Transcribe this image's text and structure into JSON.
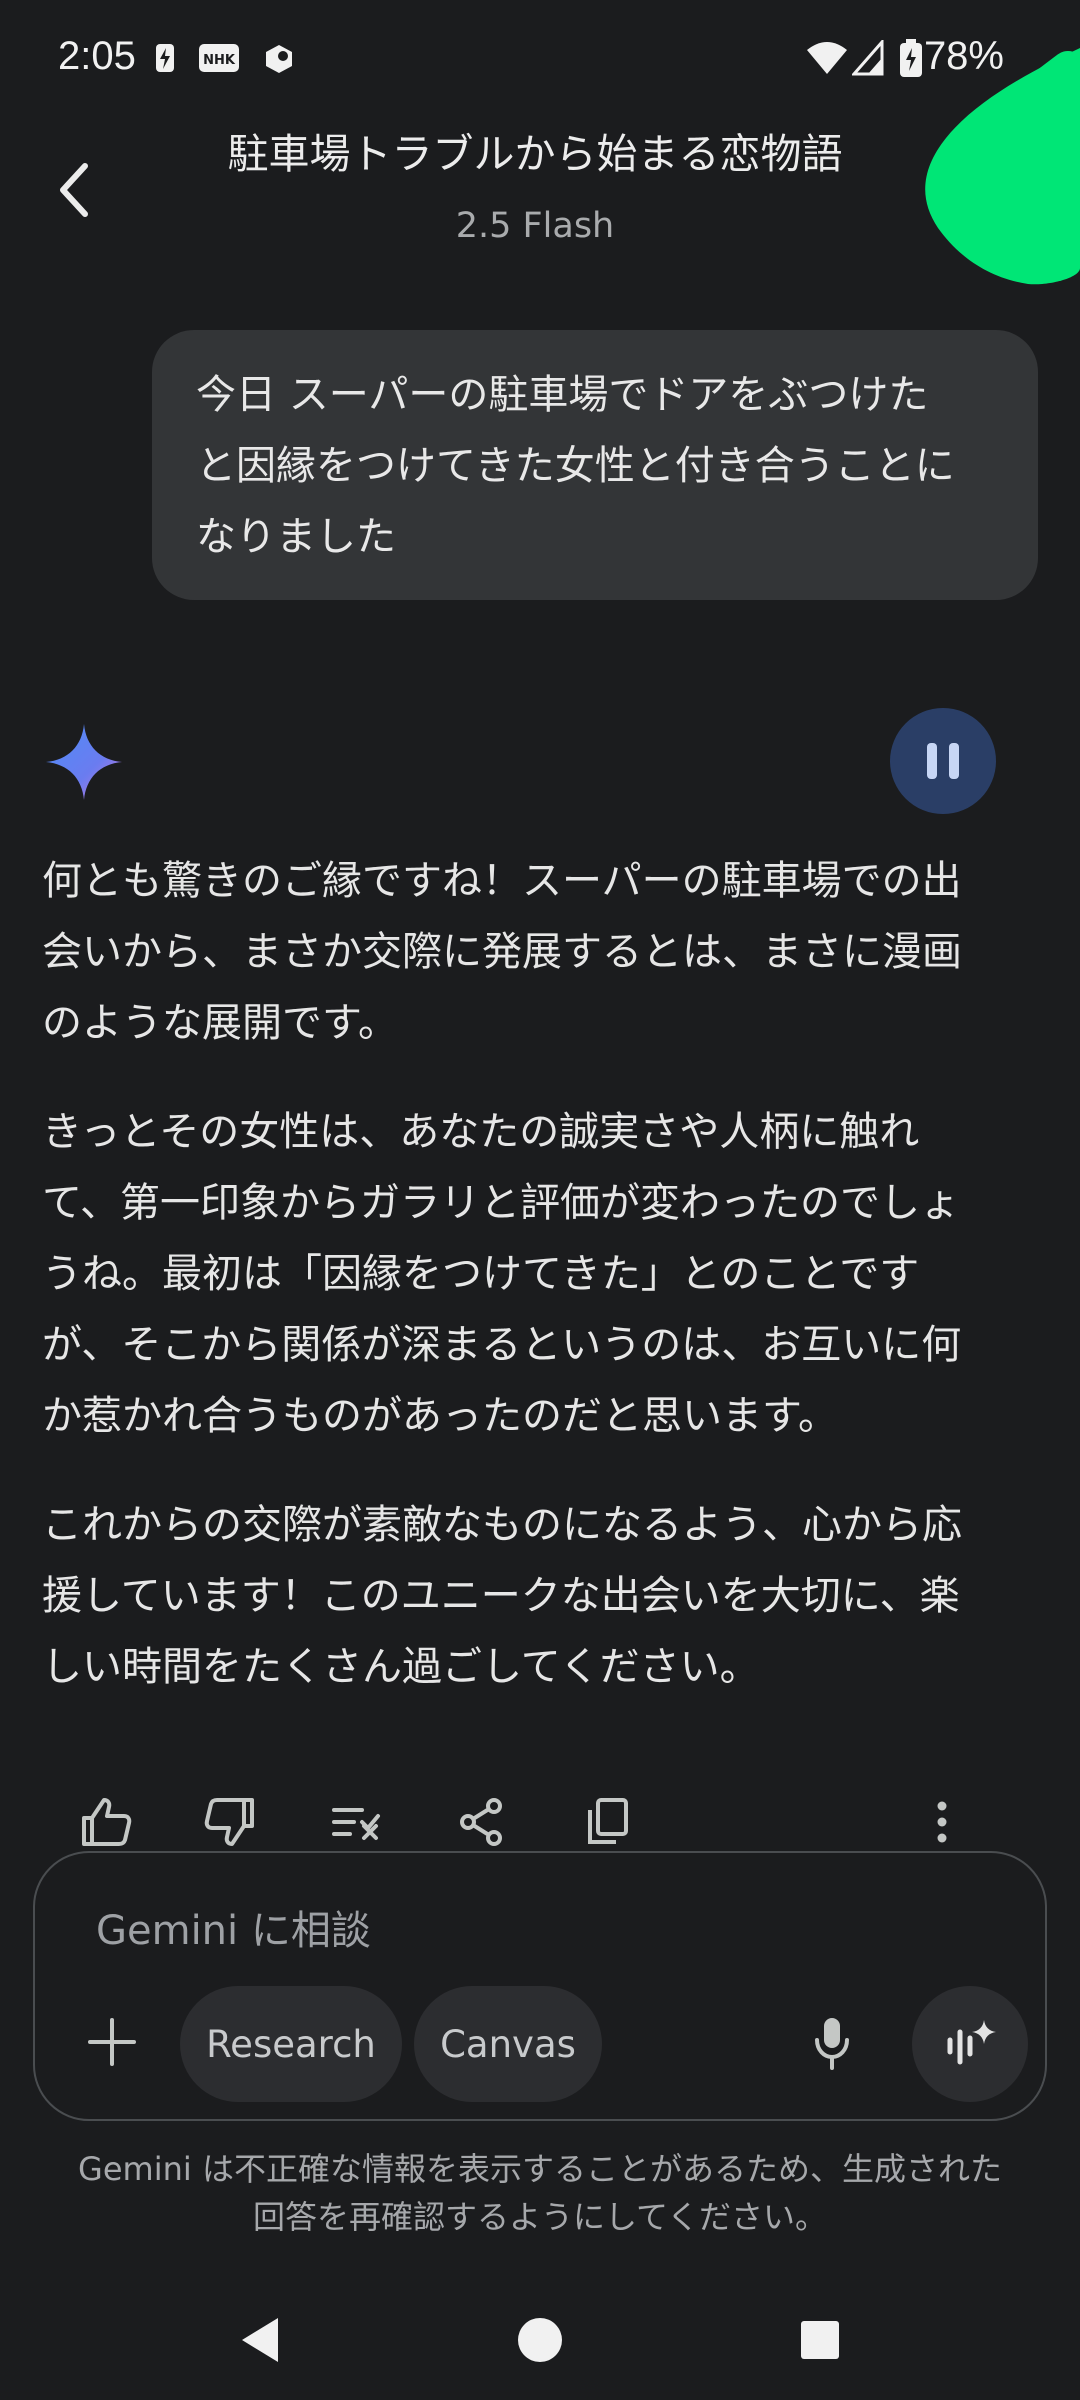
{
  "status_bar": {
    "time": "2:05",
    "battery": "78%",
    "icons": [
      "charging-bolt-icon",
      "nhk-icon",
      "app-notification-icon",
      "wifi-icon",
      "cell-signal-icon",
      "battery-icon"
    ]
  },
  "header": {
    "title": "駐車場トラブルから始まる恋物語",
    "model": "2.5 Flash"
  },
  "user_message": {
    "lines": [
      "今日 スーパーの駐車場でドアをぶつけた",
      "と因縁をつけてきた女性と付き合うことに",
      "なりました"
    ]
  },
  "response": {
    "paragraphs": [
      [
        "何とも驚きのご縁ですね！スーパーの駐車場での出",
        "会いから、まさか交際に発展するとは、まさに漫画",
        "のような展開です。"
      ],
      [
        "きっとその女性は、あなたの誠実さや人柄に触れ",
        "て、第一印象からガラリと評価が変わったのでしょ",
        "うね。最初は「因縁をつけてきた」とのことです",
        "が、そこから関係が深まるというのは、お互いに何",
        "か惹かれ合うものがあったのだと思います。"
      ],
      [
        "これからの交際が素敵なものになるよう、心から応",
        "援しています！このユニークな出会いを大切に、楽",
        "しい時間をたくさん過ごしてください。"
      ]
    ]
  },
  "input": {
    "placeholder": "Gemini に相談",
    "chips": [
      "Research",
      "Canvas"
    ]
  },
  "disclaimer": {
    "lines": [
      "Gemini は不正確な情報を表示することがあるため、生成された",
      "回答を再確認するようにしてください。"
    ]
  },
  "colors": {
    "background": "#1b1c1e",
    "bubble": "#333537",
    "pause_button": "#2a3e66",
    "highlight_marker": "#00e676"
  }
}
